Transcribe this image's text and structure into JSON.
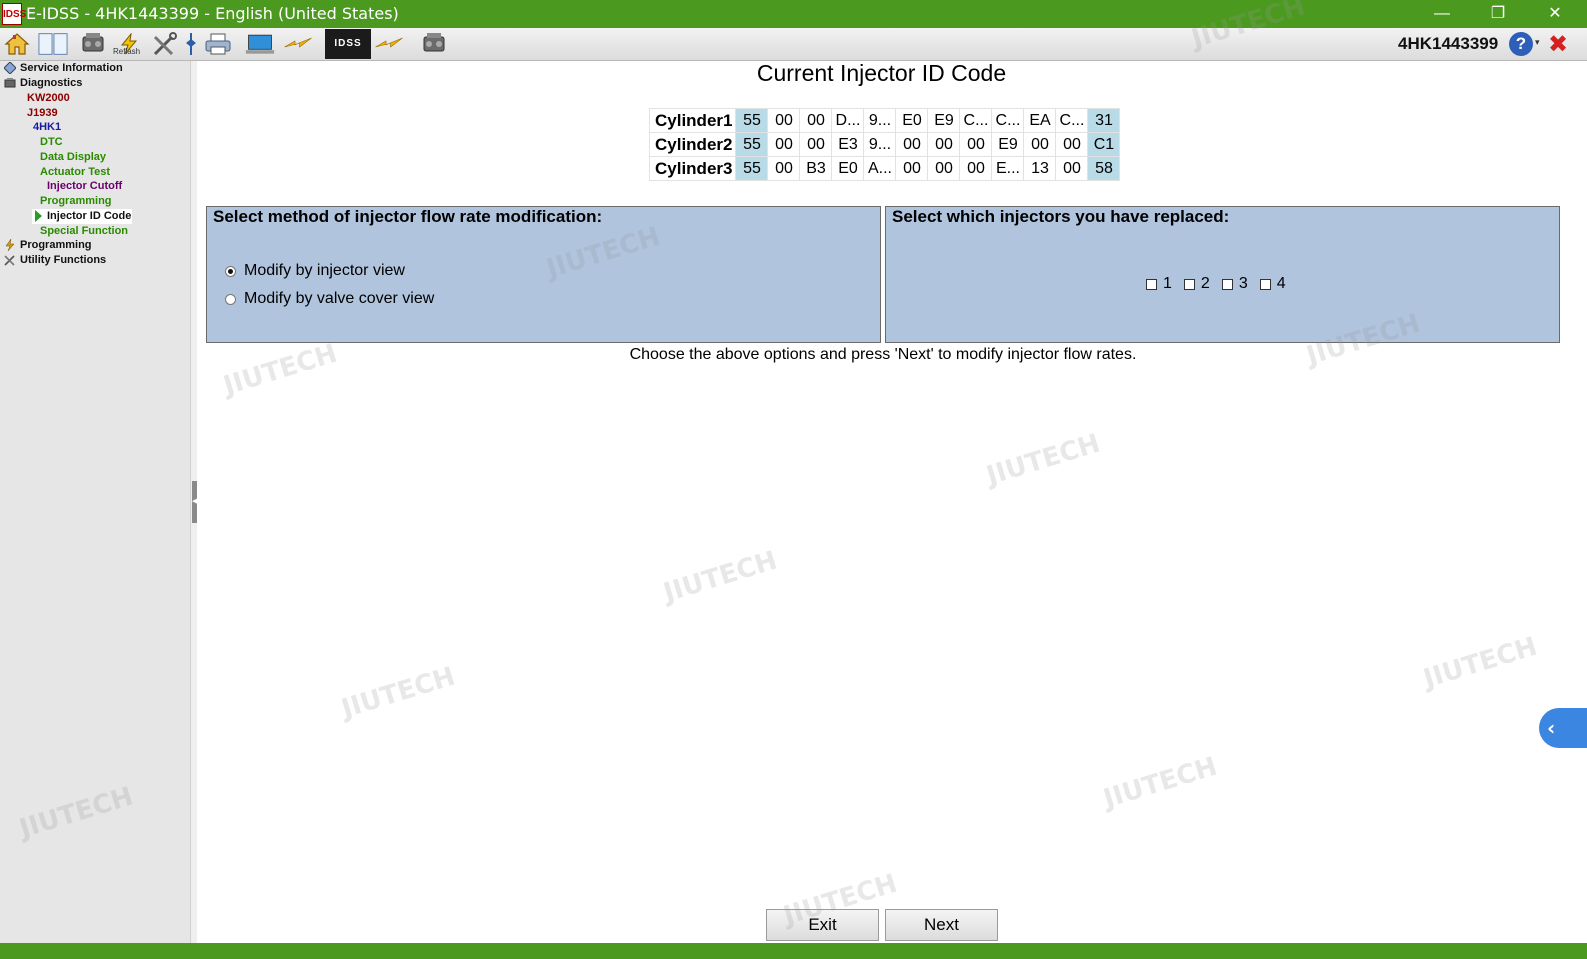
{
  "window": {
    "app_icon": "IDSS",
    "title": "E-IDSS - 4HK1443399 - English (United States)",
    "minimize_glyph": "—",
    "maximize_glyph": "❐",
    "close_glyph": "✕"
  },
  "toolbar": {
    "icons": [
      "home-icon",
      "book-icon",
      "engine-icon",
      "reflash-icon",
      "tools-icon",
      "pin-icon",
      "printer-icon",
      "laptop-icon",
      "lightning-icon",
      "ids-logo",
      "lightning-icon",
      "engine-icon"
    ],
    "refresh_label": "Reflash",
    "ids_logo_text": "IDSS",
    "vin": "4HK1443399",
    "help_glyph": "?",
    "dropdown_glyph": "▾",
    "close_glyph": "✖"
  },
  "sidebar": {
    "items": [
      {
        "label": "Service Information",
        "color": "#111111",
        "icon": "diamond-icon"
      },
      {
        "label": "Diagnostics",
        "color": "#111111",
        "icon": "engine-icon"
      },
      {
        "label": "KW2000",
        "color": "#8b0000"
      },
      {
        "label": "J1939",
        "color": "#8b0000"
      },
      {
        "label": "4HK1",
        "color": "#1a1aa0"
      },
      {
        "label": "DTC",
        "color": "#2a8a00"
      },
      {
        "label": "Data Display",
        "color": "#2a8a00"
      },
      {
        "label": "Actuator Test",
        "color": "#2a8a00"
      },
      {
        "label": "Injector Cutoff",
        "color": "#6a006a"
      },
      {
        "label": "Programming",
        "color": "#2a8a00"
      },
      {
        "label": "Injector ID Code",
        "color": "#111111",
        "selected": true
      },
      {
        "label": "Special Function",
        "color": "#2a8a00"
      },
      {
        "label": "Programming",
        "color": "#111111",
        "icon": "programming-icon"
      },
      {
        "label": "Utility Functions",
        "color": "#111111",
        "icon": "tools-icon"
      }
    ]
  },
  "main": {
    "title": "Current Injector ID Code",
    "injector_table": [
      {
        "cylinder": "Cylinder1",
        "codes": [
          "55",
          "00",
          "00",
          "D...",
          "9...",
          "E0",
          "E9",
          "C...",
          "C...",
          "EA",
          "C...",
          "31"
        ]
      },
      {
        "cylinder": "Cylinder2",
        "codes": [
          "55",
          "00",
          "00",
          "E3",
          "9...",
          "00",
          "00",
          "00",
          "E9",
          "00",
          "00",
          "C1"
        ]
      },
      {
        "cylinder": "Cylinder3",
        "codes": [
          "55",
          "00",
          "B3",
          "E0",
          "A...",
          "00",
          "00",
          "00",
          "E...",
          "13",
          "00",
          "58"
        ]
      }
    ],
    "method_panel": {
      "title": "Select method of injector flow rate modification:",
      "options": [
        {
          "label": "Modify by injector view",
          "checked": true
        },
        {
          "label": "Modify by valve cover view",
          "checked": false
        }
      ]
    },
    "replaced_panel": {
      "title": "Select which injectors you have replaced:",
      "checkboxes": [
        "1",
        "2",
        "3",
        "4"
      ]
    },
    "instruction": "Choose the above options and press 'Next' to modify injector flow rates.",
    "buttons": {
      "exit": "Exit",
      "next": "Next"
    },
    "side_tab_glyph": "‹"
  },
  "watermark": "JIUTECH",
  "colors": {
    "titlebar": "#4b9a1f",
    "panel": "#b0c4de",
    "highlight_cell": "#b9dbe8"
  }
}
